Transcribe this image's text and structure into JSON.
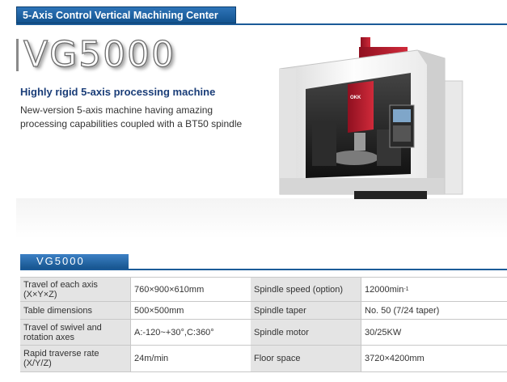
{
  "header": {
    "category": "5-Axis Control Vertical Machining Center"
  },
  "hero": {
    "model": "VG5000",
    "tagline": "Highly rigid 5-axis processing machine",
    "description_line1": "New-version 5-axis machine having amazing",
    "description_line2": "processing capabilities coupled with a BT50 spindle",
    "machine_brand": "OKK"
  },
  "specs": {
    "label": "VG5000",
    "rows": [
      {
        "left_label_1": "Travel of each axis",
        "left_label_2": "(X×Y×Z)",
        "left_value": "760×900×610mm",
        "right_label_1": "Spindle speed (option)",
        "right_value": "12000min",
        "right_value_sup": "-1"
      },
      {
        "left_label_1": "Table dimensions",
        "left_value": "500×500mm",
        "right_label_1": "Spindle taper",
        "right_value": "No. 50 (7/24 taper)"
      },
      {
        "left_label_1": "Travel of swivel and",
        "left_label_2": "rotation axes",
        "left_value": "A:-120~+30°,C:360°",
        "right_label_1": "Spindle motor",
        "right_value": "30/25KW"
      },
      {
        "left_label_1": "Rapid traverse rate",
        "left_label_2": "(X/Y/Z)",
        "left_value": "24m/min",
        "right_label_1": "Floor space",
        "right_value": "3720×4200mm"
      }
    ]
  },
  "colors": {
    "header_blue": "#1b5b98",
    "title_navy": "#1a3d78",
    "machine_red": "#b0192c"
  }
}
